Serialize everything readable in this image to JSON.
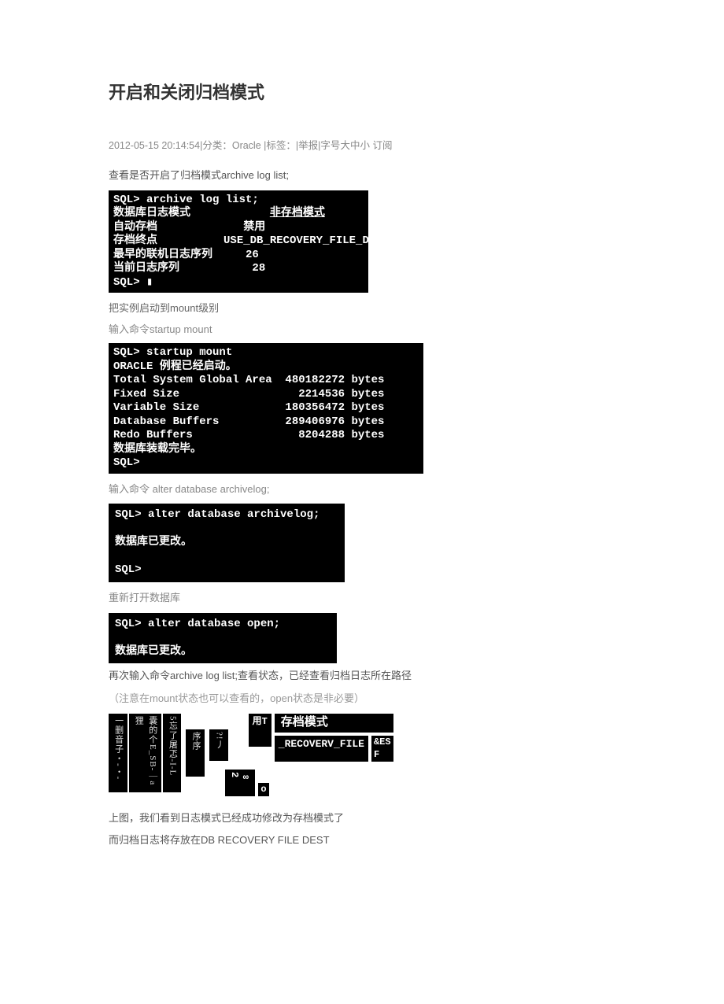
{
  "title": "开启和关闭归档模式",
  "meta": {
    "datetime": "2012-05-15 20:14:54",
    "category_label": "分类：",
    "category_value": "Oracle ",
    "tags_label": "标签：",
    "report": "举报",
    "fontsize_label": "字号",
    "font_large": "大",
    "font_mid": "中",
    "font_small": "小",
    "subscribe": " 订阅"
  },
  "p1": "查看是否开启了归档模式archive log list;",
  "term1": {
    "l1": "SQL> archive log list;",
    "l2a": "数据库日志模式",
    "l2b": "非存档模式",
    "l3a": "自动存档",
    "l3b": "禁用",
    "l4a": "存档终点",
    "l4b": "USE_DB_RECOVERY_FILE_DEST",
    "l5a": "最早的联机日志序列",
    "l5b": "26",
    "l6a": "当前日志序列",
    "l6b": "28",
    "l7": "SQL> "
  },
  "p2": "把实例启动到mount级别",
  "p3": "输入命令startup mount",
  "term2": {
    "l1": "SQL> startup mount",
    "l2": "ORACLE 例程已经启动。",
    "l3": "",
    "l4": "Total System Global Area  480182272 bytes",
    "l5": "Fixed Size                  2214536 bytes",
    "l6": "Variable Size             180356472 bytes",
    "l7": "Database Buffers          289406976 bytes",
    "l8": "Redo Buffers                8204288 bytes",
    "l9": "数据库装载完毕。",
    "l10": "SQL>"
  },
  "p4": "输入命令 alter database archivelog;",
  "term3": {
    "l1": "SQL> alter database archivelog;",
    "l2": " ",
    "l3": "数据库已更改。",
    "l4": " ",
    "l5": "SQL>"
  },
  "p5": "重新打开数据库",
  "term4": {
    "l1": "SQL> alter database open;",
    "l2": " ",
    "l3": "数据库已更改。"
  },
  "p6": "再次输入命令archive log list;查看状态，已经查看归档日志所在路径",
  "p7": "（注意在mount状态也可以查看的，open状态是非必要）",
  "frag": {
    "v1": "一删音子・-・-",
    "v2": "囊的个E_SB-｜a狸",
    "v3": "5忘了屠忑-I-L",
    "v4": "序序",
    "v5": "?!丿",
    "mid": "用T",
    "mode": "存档模式",
    "file": "_RECOVERV_FILE",
    "es": "&ES",
    "f": "F",
    "n1": "∞ 2",
    "n2": "o"
  },
  "p8": "上图，我们看到日志模式已经成功修改为存档模式了",
  "p9": "而归档日志将存放在DB RECOVERY FILE DEST"
}
